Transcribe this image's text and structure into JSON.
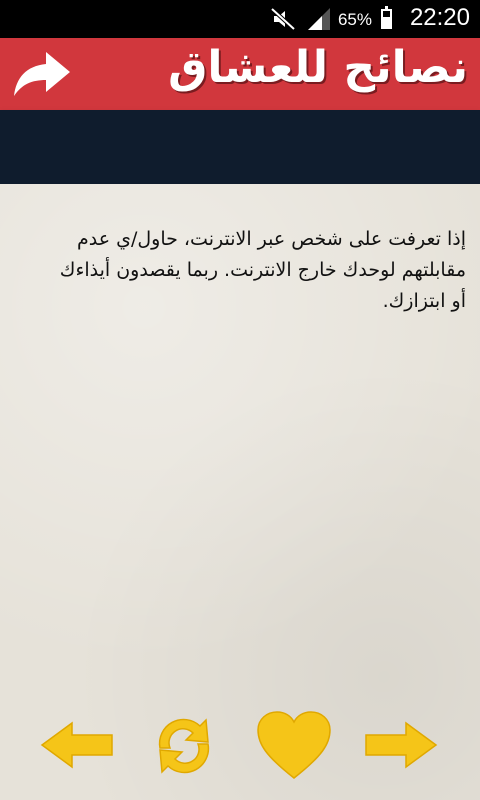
{
  "status_bar": {
    "time": "22:20",
    "battery_percent": "65%",
    "battery_level": 0.65,
    "icons": [
      "mute-icon",
      "signal-icon",
      "battery-icon"
    ]
  },
  "app_bar": {
    "title": "نصائح للعشاق",
    "share_icon": "share-arrow-icon",
    "background": "#d1373d"
  },
  "band": {
    "background": "#0f1c2d"
  },
  "tip": {
    "text": "إذا تعرفت على شخص عبر الانترنت، حاول/ي عدم مقابلتهم لوحدك خارج الانترنت. ربما يقصدون أيذاءك أو ابتزازك."
  },
  "controls": {
    "accent": "#f5c518",
    "buttons": [
      "previous-arrow-icon",
      "refresh-icon",
      "heart-icon",
      "next-arrow-icon"
    ]
  }
}
